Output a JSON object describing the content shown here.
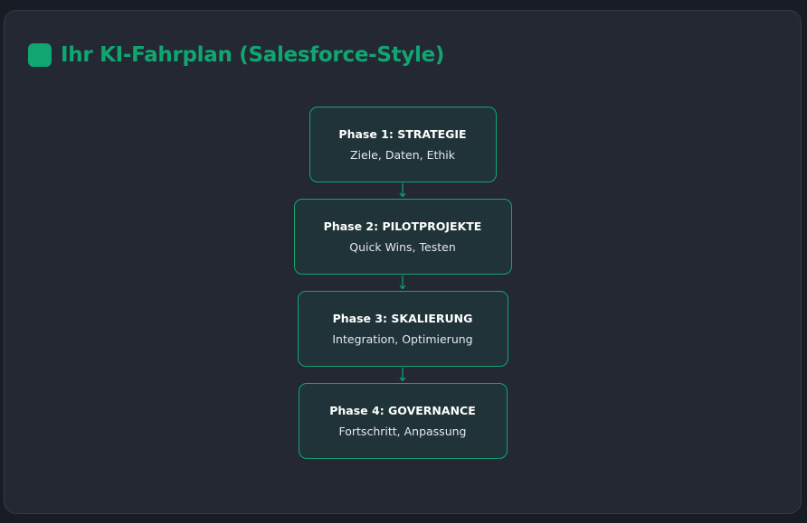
{
  "header": {
    "title": "Ihr KI-Fahrplan (Salesforce-Style)",
    "icon": "green-square-icon"
  },
  "colors": {
    "accent": "#10a671",
    "page_background": "#181c25",
    "card_background": "#242833",
    "node_background": "#1f3338"
  },
  "phases": [
    {
      "title": "Phase 1: STRATEGIE",
      "description": "Ziele, Daten, Ethik"
    },
    {
      "title": "Phase 2: PILOTPROJEKTE",
      "description": "Quick Wins, Testen"
    },
    {
      "title": "Phase 3: SKALIERUNG",
      "description": "Integration, Optimierung"
    },
    {
      "title": "Phase 4: GOVERNANCE",
      "description": "Fortschritt, Anpassung"
    }
  ]
}
